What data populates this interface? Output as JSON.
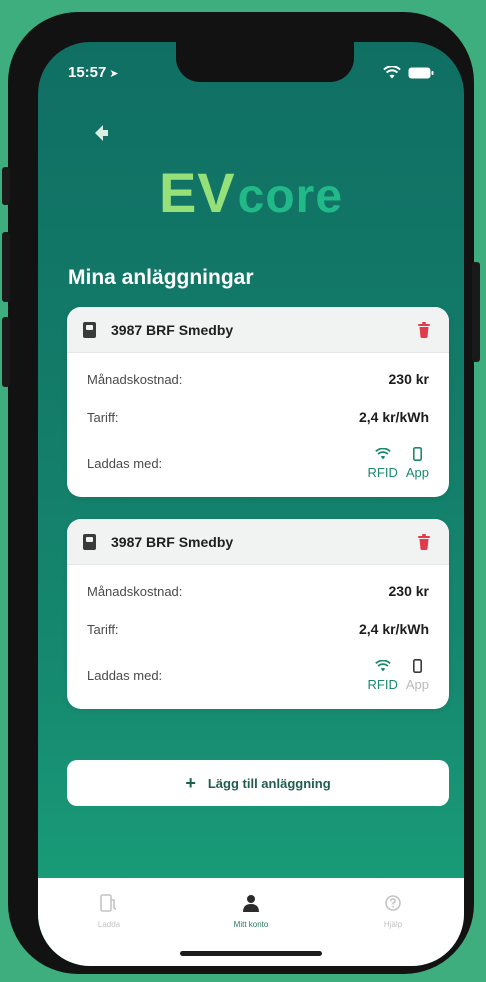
{
  "status_bar": {
    "time": "15:57"
  },
  "logo": {
    "ev": "EV",
    "core": "core"
  },
  "section_title": "Mina anläggningar",
  "stations": [
    {
      "name": "3987 BRF Smedby",
      "monthly_label": "Månadskostnad:",
      "monthly_value": "230 kr",
      "tariff_label": "Tariff:",
      "tariff_value": "2,4 kr/kWh",
      "charge_label": "Laddas med:",
      "methods": [
        {
          "label": "RFID",
          "icon": "wifi-icon",
          "enabled": true
        },
        {
          "label": "App",
          "icon": "phone-icon",
          "enabled": true
        }
      ]
    },
    {
      "name": "3987 BRF Smedby",
      "monthly_label": "Månadskostnad:",
      "monthly_value": "230 kr",
      "tariff_label": "Tariff:",
      "tariff_value": "2,4 kr/kWh",
      "charge_label": "Laddas med:",
      "methods": [
        {
          "label": "RFID",
          "icon": "wifi-icon",
          "enabled": true
        },
        {
          "label": "App",
          "icon": "phone-icon",
          "enabled": false
        }
      ]
    }
  ],
  "add_button": {
    "label": "Lägg till anläggning"
  },
  "tabs": [
    {
      "label": "Ladda",
      "icon": "charger-icon",
      "active": false
    },
    {
      "label": "Mitt konto",
      "icon": "user-icon",
      "active": true
    },
    {
      "label": "Hjälp",
      "icon": "help-icon",
      "active": false
    }
  ],
  "colors": {
    "accent": "#1a8a6a",
    "logo_ev": "#96e07a",
    "logo_core": "#22b989",
    "danger": "#e23a4a"
  }
}
